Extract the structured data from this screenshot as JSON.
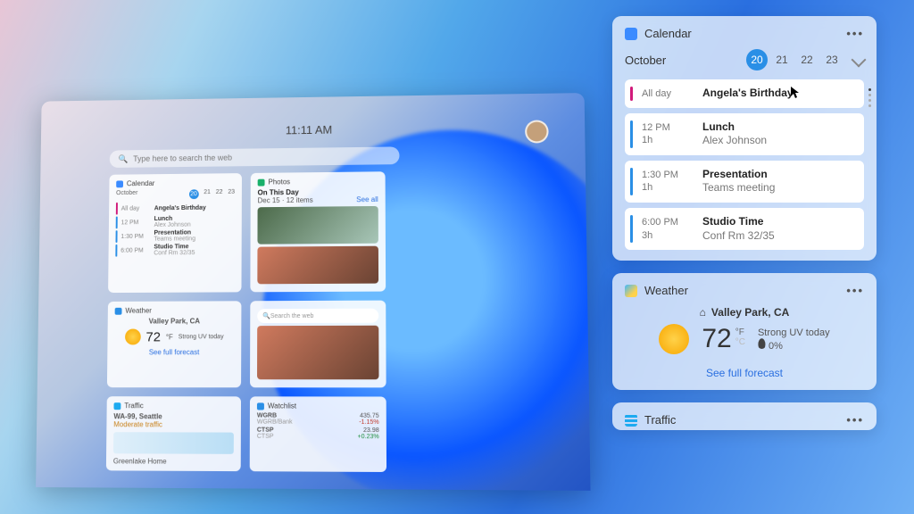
{
  "laptop": {
    "clock": "11:11 AM",
    "search_placeholder": "Type here to search the web",
    "mini_calendar": {
      "title": "Calendar",
      "month": "October",
      "days": [
        "20",
        "21",
        "22",
        "23"
      ],
      "events": [
        {
          "color": "#d11a7a",
          "time": "All day",
          "title": "Angela's Birthday"
        },
        {
          "color": "#2a8fe6",
          "time": "12 PM",
          "title": "Lunch",
          "sub": "Alex Johnson"
        },
        {
          "color": "#2a8fe6",
          "time": "1:30 PM",
          "title": "Presentation",
          "sub": "Teams meeting"
        },
        {
          "color": "#2a8fe6",
          "time": "6:00 PM",
          "title": "Studio Time",
          "sub": "Conf Rm 32/35"
        }
      ]
    },
    "mini_photos": {
      "title": "Photos",
      "headline": "On This Day",
      "sub": "Dec 15 · 12 items",
      "see_all": "See all"
    },
    "mini_weather": {
      "title": "Weather",
      "location": "Valley Park, CA",
      "temp": "72",
      "unit": "°F",
      "cond": "Strong UV today",
      "link": "See full forecast"
    },
    "mini_search": {
      "placeholder": "Search the web"
    },
    "mini_traffic": {
      "title": "Traffic",
      "line1": "WA-99, Seattle",
      "line2": "Moderate traffic",
      "line3": "Greenlake Home"
    },
    "mini_watchlist": {
      "title": "Watchlist",
      "rows": [
        {
          "sym": "WGRB",
          "sub": "WGRB/Bank",
          "val": "435.75",
          "chg": "-1.15%"
        },
        {
          "sym": "CTSP",
          "sub": "CTSP",
          "val": "23.98",
          "chg": "+0.23%"
        }
      ]
    }
  },
  "calendar": {
    "title": "Calendar",
    "month": "October",
    "days": [
      "20",
      "21",
      "22",
      "23"
    ],
    "selected_index": 0,
    "events": [
      {
        "color": "#d11a7a",
        "time": "All day",
        "duration": "",
        "title": "Angela's Birthday",
        "sub": ""
      },
      {
        "color": "#2a8fe6",
        "time": "12 PM",
        "duration": "1h",
        "title": "Lunch",
        "sub": "Alex Johnson"
      },
      {
        "color": "#2a8fe6",
        "time": "1:30 PM",
        "duration": "1h",
        "title": "Presentation",
        "sub": "Teams meeting"
      },
      {
        "color": "#2a8fe6",
        "time": "6:00 PM",
        "duration": "3h",
        "title": "Studio Time",
        "sub": "Conf Rm 32/35"
      }
    ]
  },
  "weather": {
    "title": "Weather",
    "location": "Valley Park, CA",
    "temp": "72",
    "unit_top": "°F",
    "unit_bottom": "°C",
    "condition": "Strong UV today",
    "precip": "0%",
    "link": "See full forecast"
  },
  "traffic": {
    "title": "Traffic"
  }
}
